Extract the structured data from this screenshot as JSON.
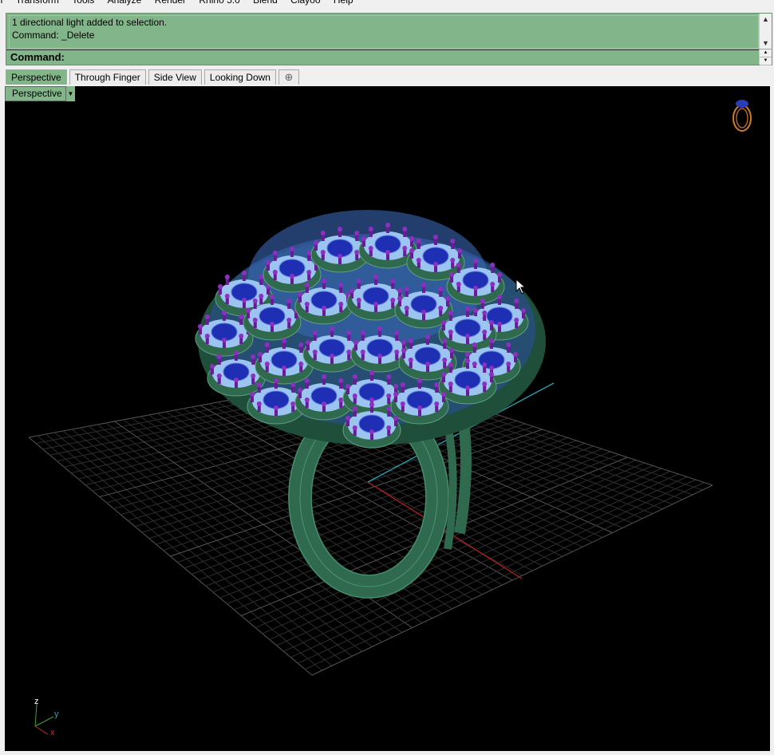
{
  "menu": {
    "items": [
      "on",
      "Transform",
      "Tools",
      "Analyze",
      "Render",
      "Rhino 5.0",
      "Blend",
      "Clayoo",
      "Help"
    ]
  },
  "command": {
    "history": [
      "1 directional light added to selection.",
      "Command: _Delete"
    ],
    "prompt": "Command:"
  },
  "tabs": [
    "Perspective",
    "Through Finger",
    "Side View",
    "Looking Down"
  ],
  "viewport": {
    "label": "Perspective",
    "axes": {
      "z": "z",
      "y": "y",
      "x": "x"
    }
  },
  "colors": {
    "command_bg": "#83b58a",
    "viewport_bg": "#000000",
    "grid": "#3a3a3a",
    "x_axis": "#b32020",
    "y_axis": "#2aa0b0",
    "gem_blue": "#1e2fb3",
    "setting_green": "#2f6a4f",
    "prong_purple": "#7a1fa6"
  }
}
